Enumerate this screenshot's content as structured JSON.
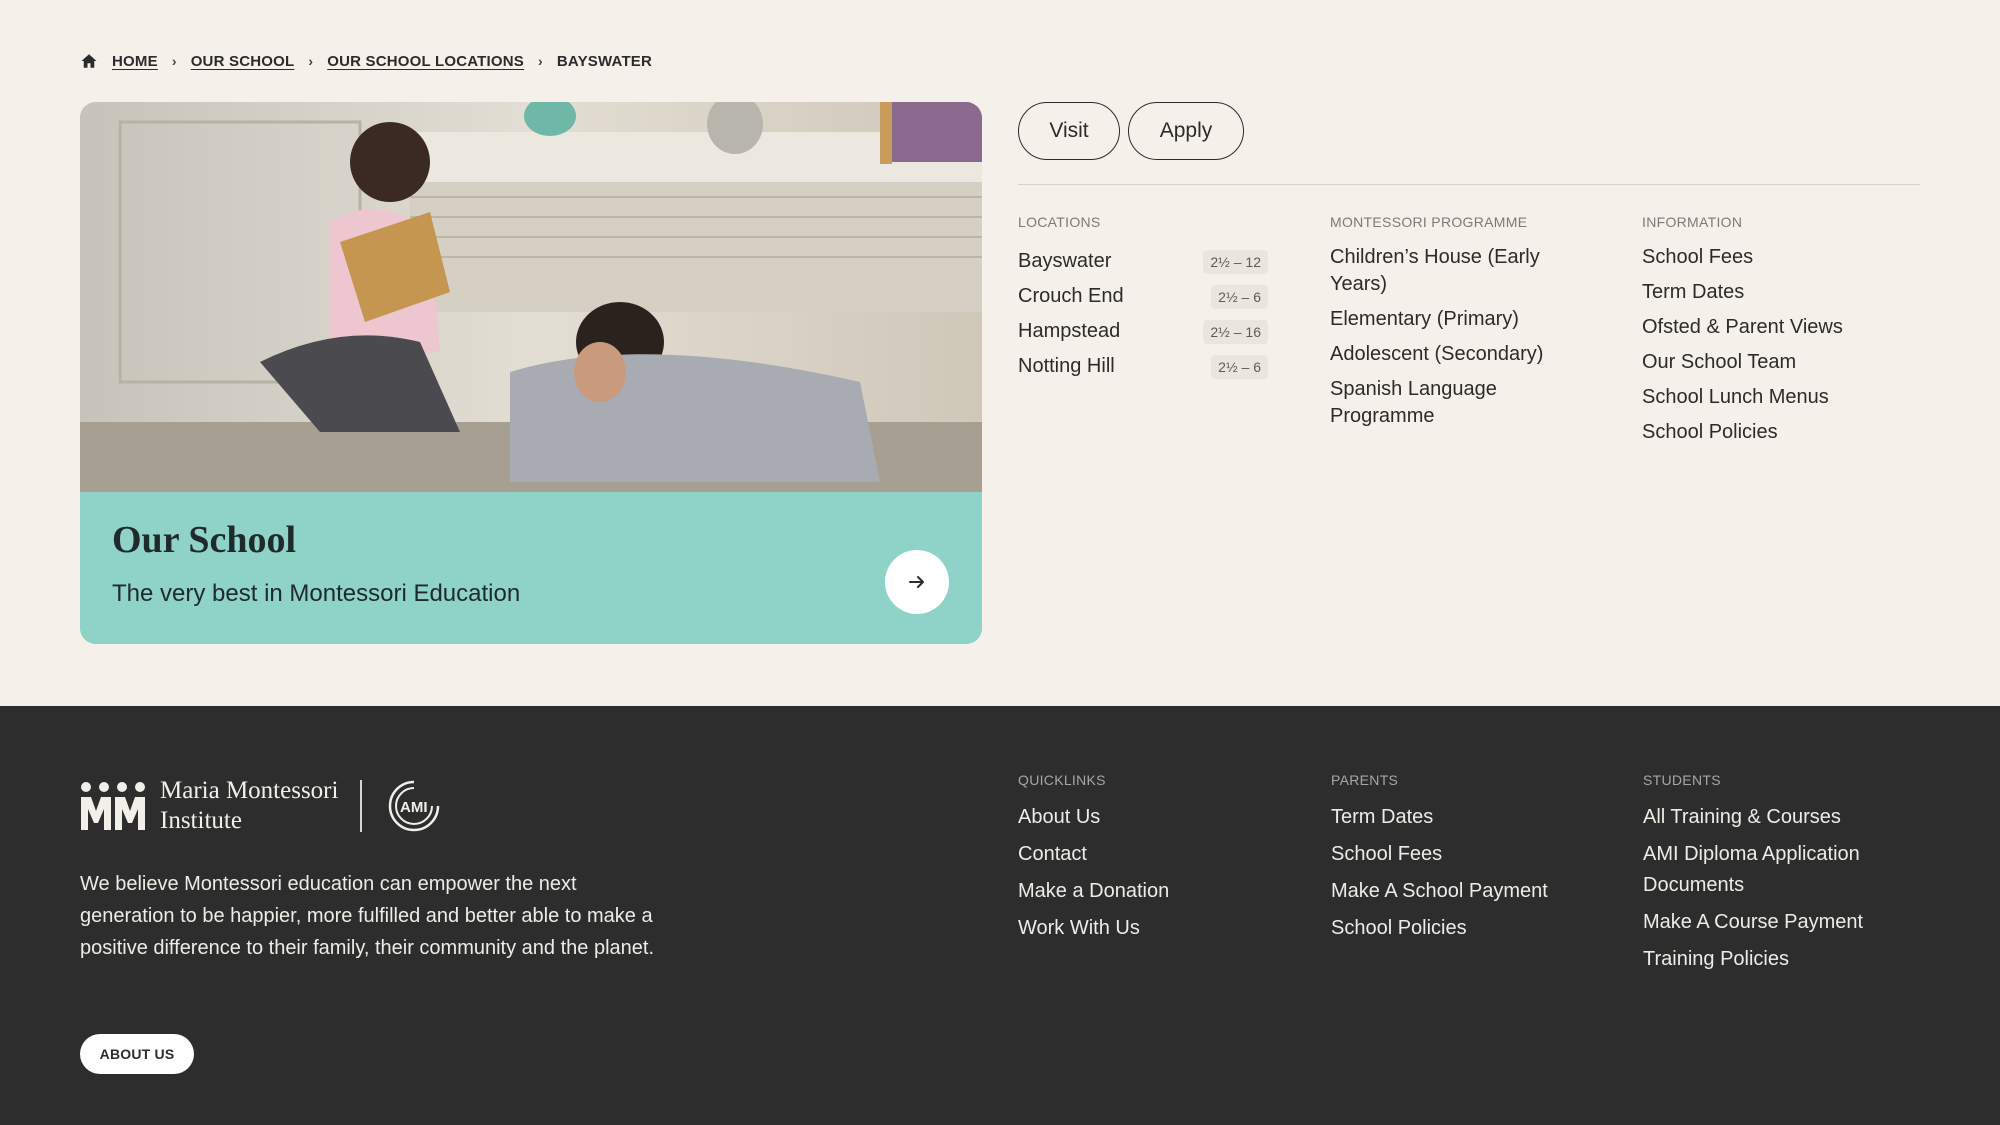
{
  "breadcrumb": {
    "icon": "home-icon",
    "items": [
      "HOME",
      "OUR SCHOOL",
      "OUR SCHOOL LOCATIONS",
      "BAYSWATER"
    ]
  },
  "hero": {
    "title": "Our School",
    "subtitle": "The very best in Montessori Education",
    "arrow_icon": "arrow-right-icon",
    "background_color": "#8ed2c8"
  },
  "actions": {
    "visit": "Visit",
    "apply": "Apply"
  },
  "menu": {
    "locations": {
      "heading": "LOCATIONS",
      "items": [
        {
          "name": "Bayswater",
          "ages": "2½ – 12"
        },
        {
          "name": "Crouch End",
          "ages": "2½ – 6"
        },
        {
          "name": "Hampstead",
          "ages": "2½ – 16"
        },
        {
          "name": "Notting Hill",
          "ages": "2½ – 6"
        }
      ]
    },
    "programme": {
      "heading": "MONTESSORI PROGRAMME",
      "items": [
        "Children’s House (Early Years)",
        "Elementary (Primary)",
        "Adolescent (Secondary)",
        "Spanish Language Programme"
      ]
    },
    "information": {
      "heading": "INFORMATION",
      "items": [
        "School Fees",
        "Term Dates",
        "Ofsted & Parent Views",
        "Our School Team",
        "School Lunch Menus",
        "School Policies"
      ]
    }
  },
  "footer": {
    "logo_line1": "Maria Montessori",
    "logo_line2": "Institute",
    "ami_badge": "AMI",
    "mission": "We believe Montessori education can empower the next generation to be happier, more fulfilled and better able to make a positive difference to their family, their community and the planet.",
    "about_button": "ABOUT US",
    "quicklinks": {
      "heading": "QUICKLINKS",
      "items": [
        "About Us",
        "Contact",
        "Make a Donation",
        "Work With Us"
      ]
    },
    "parents": {
      "heading": "PARENTS",
      "items": [
        "Term Dates",
        "School Fees",
        "Make A School Payment",
        "School Policies"
      ]
    },
    "students": {
      "heading": "STUDENTS",
      "items": [
        "All Training & Courses",
        "AMI Diploma Application Documents",
        "Make A Course Payment",
        "Training Policies"
      ]
    }
  }
}
